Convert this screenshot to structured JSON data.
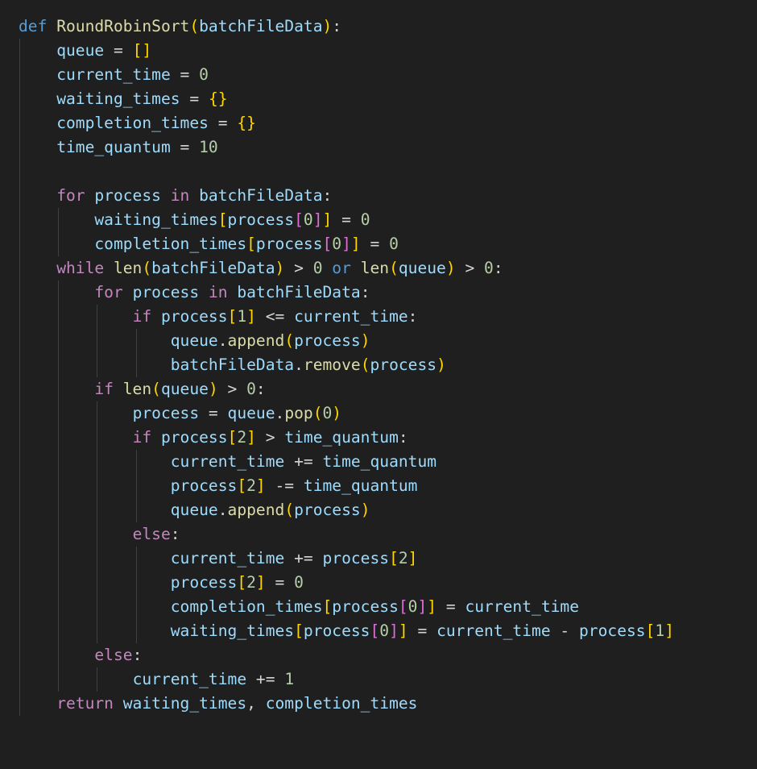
{
  "editor": {
    "language": "python",
    "colors": {
      "background": "#1f1f1f",
      "keyword": "#569cd6",
      "control": "#c586c0",
      "function": "#dcdcaa",
      "variable": "#9cdcfe",
      "number": "#b5cea8",
      "operator": "#d4d4d4",
      "bracket1": "#ffd700",
      "bracket2": "#da70d6"
    },
    "lines": [
      {
        "indent": 0,
        "tokens": [
          [
            "kw",
            "def"
          ],
          [
            "op",
            " "
          ],
          [
            "fn",
            "RoundRobinSort"
          ],
          [
            "b1",
            "("
          ],
          [
            "var",
            "batchFileData"
          ],
          [
            "b1",
            ")"
          ],
          [
            "op",
            ":"
          ]
        ]
      },
      {
        "indent": 1,
        "tokens": [
          [
            "var",
            "queue"
          ],
          [
            "op",
            " = "
          ],
          [
            "b1",
            "[]"
          ]
        ]
      },
      {
        "indent": 1,
        "tokens": [
          [
            "var",
            "current_time"
          ],
          [
            "op",
            " = "
          ],
          [
            "num",
            "0"
          ]
        ]
      },
      {
        "indent": 1,
        "tokens": [
          [
            "var",
            "waiting_times"
          ],
          [
            "op",
            " = "
          ],
          [
            "b1",
            "{}"
          ]
        ]
      },
      {
        "indent": 1,
        "tokens": [
          [
            "var",
            "completion_times"
          ],
          [
            "op",
            " = "
          ],
          [
            "b1",
            "{}"
          ]
        ]
      },
      {
        "indent": 1,
        "tokens": [
          [
            "var",
            "time_quantum"
          ],
          [
            "op",
            " = "
          ],
          [
            "num",
            "10"
          ]
        ]
      },
      {
        "indent": 1,
        "tokens": []
      },
      {
        "indent": 1,
        "tokens": [
          [
            "ctl",
            "for"
          ],
          [
            "op",
            " "
          ],
          [
            "var",
            "process"
          ],
          [
            "op",
            " "
          ],
          [
            "ctl",
            "in"
          ],
          [
            "op",
            " "
          ],
          [
            "var",
            "batchFileData"
          ],
          [
            "op",
            ":"
          ]
        ]
      },
      {
        "indent": 2,
        "tokens": [
          [
            "var",
            "waiting_times"
          ],
          [
            "b1",
            "["
          ],
          [
            "var",
            "process"
          ],
          [
            "b2",
            "["
          ],
          [
            "num",
            "0"
          ],
          [
            "b2",
            "]"
          ],
          [
            "b1",
            "]"
          ],
          [
            "op",
            " = "
          ],
          [
            "num",
            "0"
          ]
        ]
      },
      {
        "indent": 2,
        "tokens": [
          [
            "var",
            "completion_times"
          ],
          [
            "b1",
            "["
          ],
          [
            "var",
            "process"
          ],
          [
            "b2",
            "["
          ],
          [
            "num",
            "0"
          ],
          [
            "b2",
            "]"
          ],
          [
            "b1",
            "]"
          ],
          [
            "op",
            " = "
          ],
          [
            "num",
            "0"
          ]
        ]
      },
      {
        "indent": 1,
        "tokens": [
          [
            "ctl",
            "while"
          ],
          [
            "op",
            " "
          ],
          [
            "fn",
            "len"
          ],
          [
            "b1",
            "("
          ],
          [
            "var",
            "batchFileData"
          ],
          [
            "b1",
            ")"
          ],
          [
            "op",
            " > "
          ],
          [
            "num",
            "0"
          ],
          [
            "op",
            " "
          ],
          [
            "kw",
            "or"
          ],
          [
            "op",
            " "
          ],
          [
            "fn",
            "len"
          ],
          [
            "b1",
            "("
          ],
          [
            "var",
            "queue"
          ],
          [
            "b1",
            ")"
          ],
          [
            "op",
            " > "
          ],
          [
            "num",
            "0"
          ],
          [
            "op",
            ":"
          ]
        ]
      },
      {
        "indent": 2,
        "tokens": [
          [
            "ctl",
            "for"
          ],
          [
            "op",
            " "
          ],
          [
            "var",
            "process"
          ],
          [
            "op",
            " "
          ],
          [
            "ctl",
            "in"
          ],
          [
            "op",
            " "
          ],
          [
            "var",
            "batchFileData"
          ],
          [
            "op",
            ":"
          ]
        ]
      },
      {
        "indent": 3,
        "tokens": [
          [
            "ctl",
            "if"
          ],
          [
            "op",
            " "
          ],
          [
            "var",
            "process"
          ],
          [
            "b1",
            "["
          ],
          [
            "num",
            "1"
          ],
          [
            "b1",
            "]"
          ],
          [
            "op",
            " <= "
          ],
          [
            "var",
            "current_time"
          ],
          [
            "op",
            ":"
          ]
        ]
      },
      {
        "indent": 4,
        "tokens": [
          [
            "var",
            "queue"
          ],
          [
            "op",
            "."
          ],
          [
            "fn",
            "append"
          ],
          [
            "b1",
            "("
          ],
          [
            "var",
            "process"
          ],
          [
            "b1",
            ")"
          ]
        ]
      },
      {
        "indent": 4,
        "tokens": [
          [
            "var",
            "batchFileData"
          ],
          [
            "op",
            "."
          ],
          [
            "fn",
            "remove"
          ],
          [
            "b1",
            "("
          ],
          [
            "var",
            "process"
          ],
          [
            "b1",
            ")"
          ]
        ]
      },
      {
        "indent": 2,
        "tokens": [
          [
            "ctl",
            "if"
          ],
          [
            "op",
            " "
          ],
          [
            "fn",
            "len"
          ],
          [
            "b1",
            "("
          ],
          [
            "var",
            "queue"
          ],
          [
            "b1",
            ")"
          ],
          [
            "op",
            " > "
          ],
          [
            "num",
            "0"
          ],
          [
            "op",
            ":"
          ]
        ]
      },
      {
        "indent": 3,
        "tokens": [
          [
            "var",
            "process"
          ],
          [
            "op",
            " = "
          ],
          [
            "var",
            "queue"
          ],
          [
            "op",
            "."
          ],
          [
            "fn",
            "pop"
          ],
          [
            "b1",
            "("
          ],
          [
            "num",
            "0"
          ],
          [
            "b1",
            ")"
          ]
        ]
      },
      {
        "indent": 3,
        "tokens": [
          [
            "ctl",
            "if"
          ],
          [
            "op",
            " "
          ],
          [
            "var",
            "process"
          ],
          [
            "b1",
            "["
          ],
          [
            "num",
            "2"
          ],
          [
            "b1",
            "]"
          ],
          [
            "op",
            " > "
          ],
          [
            "var",
            "time_quantum"
          ],
          [
            "op",
            ":"
          ]
        ]
      },
      {
        "indent": 4,
        "tokens": [
          [
            "var",
            "current_time"
          ],
          [
            "op",
            " += "
          ],
          [
            "var",
            "time_quantum"
          ]
        ]
      },
      {
        "indent": 4,
        "tokens": [
          [
            "var",
            "process"
          ],
          [
            "b1",
            "["
          ],
          [
            "num",
            "2"
          ],
          [
            "b1",
            "]"
          ],
          [
            "op",
            " -= "
          ],
          [
            "var",
            "time_quantum"
          ]
        ]
      },
      {
        "indent": 4,
        "tokens": [
          [
            "var",
            "queue"
          ],
          [
            "op",
            "."
          ],
          [
            "fn",
            "append"
          ],
          [
            "b1",
            "("
          ],
          [
            "var",
            "process"
          ],
          [
            "b1",
            ")"
          ]
        ]
      },
      {
        "indent": 3,
        "tokens": [
          [
            "ctl",
            "else"
          ],
          [
            "op",
            ":"
          ]
        ]
      },
      {
        "indent": 4,
        "tokens": [
          [
            "var",
            "current_time"
          ],
          [
            "op",
            " += "
          ],
          [
            "var",
            "process"
          ],
          [
            "b1",
            "["
          ],
          [
            "num",
            "2"
          ],
          [
            "b1",
            "]"
          ]
        ]
      },
      {
        "indent": 4,
        "tokens": [
          [
            "var",
            "process"
          ],
          [
            "b1",
            "["
          ],
          [
            "num",
            "2"
          ],
          [
            "b1",
            "]"
          ],
          [
            "op",
            " = "
          ],
          [
            "num",
            "0"
          ]
        ]
      },
      {
        "indent": 4,
        "tokens": [
          [
            "var",
            "completion_times"
          ],
          [
            "b1",
            "["
          ],
          [
            "var",
            "process"
          ],
          [
            "b2",
            "["
          ],
          [
            "num",
            "0"
          ],
          [
            "b2",
            "]"
          ],
          [
            "b1",
            "]"
          ],
          [
            "op",
            " = "
          ],
          [
            "var",
            "current_time"
          ]
        ]
      },
      {
        "indent": 4,
        "tokens": [
          [
            "var",
            "waiting_times"
          ],
          [
            "b1",
            "["
          ],
          [
            "var",
            "process"
          ],
          [
            "b2",
            "["
          ],
          [
            "num",
            "0"
          ],
          [
            "b2",
            "]"
          ],
          [
            "b1",
            "]"
          ],
          [
            "op",
            " = "
          ],
          [
            "var",
            "current_time"
          ],
          [
            "op",
            " - "
          ],
          [
            "var",
            "process"
          ],
          [
            "b1",
            "["
          ],
          [
            "num",
            "1"
          ],
          [
            "b1",
            "]"
          ]
        ]
      },
      {
        "indent": 2,
        "tokens": [
          [
            "ctl",
            "else"
          ],
          [
            "op",
            ":"
          ]
        ]
      },
      {
        "indent": 3,
        "tokens": [
          [
            "var",
            "current_time"
          ],
          [
            "op",
            " += "
          ],
          [
            "num",
            "1"
          ]
        ]
      },
      {
        "indent": 1,
        "tokens": [
          [
            "ctl",
            "return"
          ],
          [
            "op",
            " "
          ],
          [
            "var",
            "waiting_times"
          ],
          [
            "op",
            ", "
          ],
          [
            "var",
            "completion_times"
          ]
        ]
      }
    ],
    "guides": [
      {
        "level": 1,
        "from": 1,
        "to": 28
      },
      {
        "level": 2,
        "from": 8,
        "to": 9
      },
      {
        "level": 2,
        "from": 11,
        "to": 27
      },
      {
        "level": 3,
        "from": 12,
        "to": 14
      },
      {
        "level": 4,
        "from": 13,
        "to": 14
      },
      {
        "level": 3,
        "from": 16,
        "to": 25
      },
      {
        "level": 4,
        "from": 18,
        "to": 20
      },
      {
        "level": 4,
        "from": 22,
        "to": 25
      },
      {
        "level": 3,
        "from": 27,
        "to": 27
      }
    ]
  }
}
